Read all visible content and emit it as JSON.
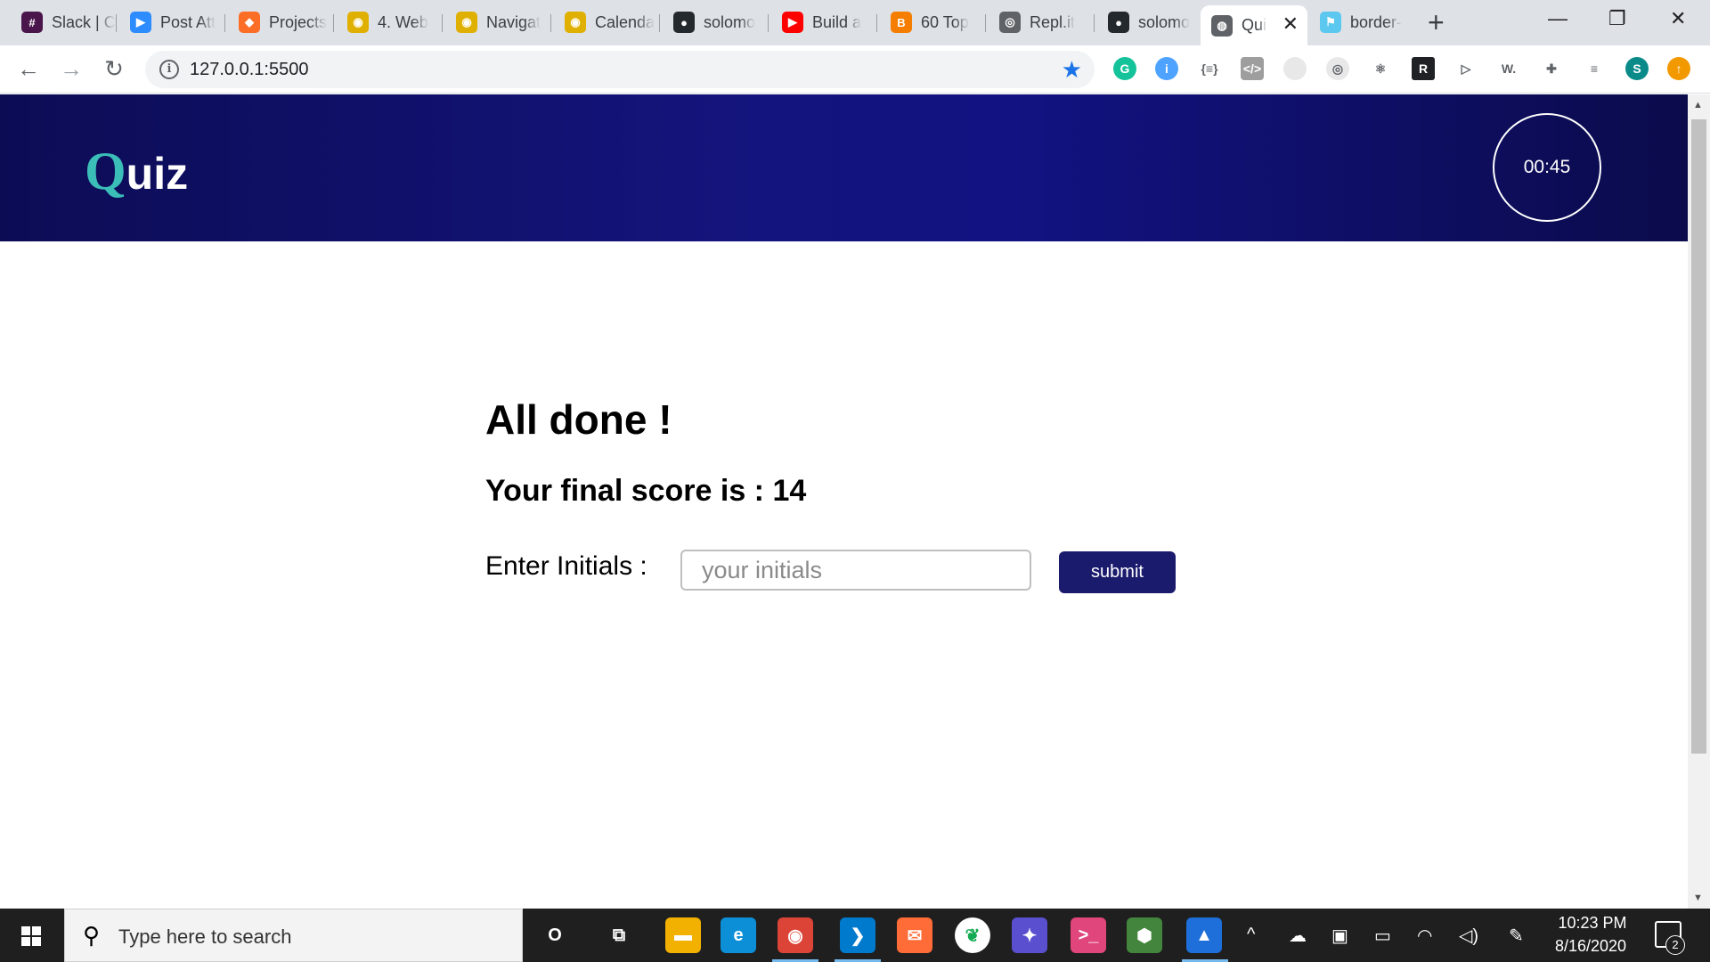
{
  "browser": {
    "tabs": [
      {
        "title": "Slack | C",
        "favicon": "slack-icon",
        "color": "#4a154b",
        "glyph": "#"
      },
      {
        "title": "Post Att",
        "favicon": "zoom-icon",
        "color": "#2d8cff",
        "glyph": "▶"
      },
      {
        "title": "Projects",
        "favicon": "gitlab-icon",
        "color": "#fc6d26",
        "glyph": "◆"
      },
      {
        "title": "4. Web",
        "favicon": "bootcamp-icon",
        "color": "#e0b000",
        "glyph": "◉"
      },
      {
        "title": "Navigat",
        "favicon": "bootcamp-icon",
        "color": "#e0b000",
        "glyph": "◉"
      },
      {
        "title": "Calenda",
        "favicon": "bootcamp-icon",
        "color": "#e0b000",
        "glyph": "◉"
      },
      {
        "title": "solomo",
        "favicon": "github-icon",
        "color": "#24292e",
        "glyph": "●"
      },
      {
        "title": "Build a",
        "favicon": "youtube-icon",
        "color": "#ff0000",
        "glyph": "▶"
      },
      {
        "title": "60 Top",
        "favicon": "blogger-icon",
        "color": "#f57d00",
        "glyph": "B"
      },
      {
        "title": "Repl.it",
        "favicon": "replit-icon",
        "color": "#5f6368",
        "glyph": "◎"
      },
      {
        "title": "solomo",
        "favicon": "github-icon",
        "color": "#24292e",
        "glyph": "●"
      },
      {
        "title": "Qui",
        "favicon": "globe-icon",
        "color": "#5f6368",
        "glyph": "◍",
        "active": true
      },
      {
        "title": "border-",
        "favicon": "flag-icon",
        "color": "#5cc8f0",
        "glyph": "⚑"
      }
    ],
    "url": "127.0.0.1:5500",
    "extensions": [
      {
        "name": "grammarly-icon",
        "color": "#15c39a",
        "glyph": "G"
      },
      {
        "name": "info-extension-icon",
        "color": "#4da3ff",
        "glyph": "i"
      },
      {
        "name": "json-viewer-icon",
        "color": "#ffffff",
        "glyph": "{≡}"
      },
      {
        "name": "code-viewer-icon",
        "color": "#9e9e9e",
        "glyph": "</>"
      },
      {
        "name": "blank-extension-icon",
        "color": "#e8e8e8",
        "glyph": ""
      },
      {
        "name": "camera-extension-icon",
        "color": "#e8e8e8",
        "glyph": "◎"
      },
      {
        "name": "react-devtools-icon",
        "color": "#ffffff",
        "glyph": "⚛"
      },
      {
        "name": "r-extension-icon",
        "color": "#202124",
        "glyph": "R"
      },
      {
        "name": "screencast-icon",
        "color": "#ffffff",
        "glyph": "▷"
      },
      {
        "name": "w-extension-icon",
        "color": "#ffffff",
        "glyph": "W."
      },
      {
        "name": "puzzle-icon",
        "color": "#ffffff",
        "glyph": "✚"
      },
      {
        "name": "media-control-icon",
        "color": "#ffffff",
        "glyph": "≡"
      },
      {
        "name": "profile-avatar-icon",
        "color": "#0b8a8a",
        "glyph": "S"
      },
      {
        "name": "update-icon",
        "color": "#f29900",
        "glyph": "↑"
      }
    ]
  },
  "quiz": {
    "logo_initial": "Q",
    "logo_rest": "uiz",
    "timer": "00:45",
    "title": "All done !",
    "score_label": "Your final score is : 14",
    "initials_label": "Enter Initials :",
    "initials_placeholder": "your initials",
    "submit_label": "submit"
  },
  "taskbar": {
    "search_placeholder": "Type here to search",
    "apps": [
      {
        "name": "cortana-icon",
        "glyph": "O",
        "color": "#1f1f1f"
      },
      {
        "name": "task-view-icon",
        "glyph": "⧉",
        "color": "#1f1f1f"
      },
      {
        "name": "file-explorer-icon",
        "glyph": "▬",
        "color": "#f2b100"
      },
      {
        "name": "edge-icon",
        "glyph": "e",
        "color": "#0c8fd6"
      },
      {
        "name": "chrome-icon",
        "glyph": "◉",
        "color": "#db4437"
      },
      {
        "name": "vscode-icon",
        "glyph": "❯",
        "color": "#007acc"
      },
      {
        "name": "postman-icon",
        "glyph": "✉",
        "color": "#ff6c37"
      },
      {
        "name": "mongodb-icon",
        "glyph": "❦",
        "color": "#ffffff"
      },
      {
        "name": "gitkraken-icon",
        "glyph": "✦",
        "color": "#5a4fcf"
      },
      {
        "name": "terminal-icon",
        "glyph": ">_",
        "color": "#e0457b"
      },
      {
        "name": "nodejs-icon",
        "glyph": "⬢",
        "color": "#43853d"
      },
      {
        "name": "photos-icon",
        "glyph": "▲",
        "color": "#1e6fd9"
      }
    ],
    "time": "10:23 PM",
    "date": "8/16/2020",
    "notification_count": "2"
  }
}
